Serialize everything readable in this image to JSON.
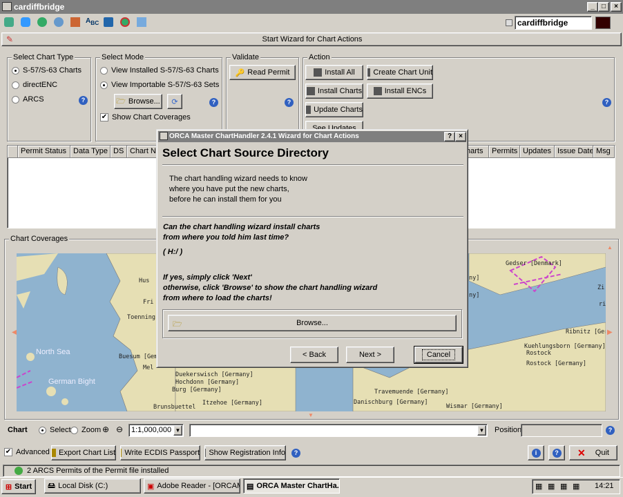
{
  "window": {
    "title": "cardiffbridge"
  },
  "toolbar": {
    "identity": "cardiffbridge",
    "wizard_label": "Start Wizard for Chart Actions"
  },
  "chart_type": {
    "label": "Select Chart Type",
    "options": [
      "S-57/S-63 Charts",
      "directENC",
      "ARCS"
    ],
    "selected": 0
  },
  "mode": {
    "label": "Select Mode",
    "options": [
      "View Installed S-57/S-63 Charts",
      "View Importable S-57/S-63 Sets"
    ],
    "selected": 1,
    "browse": "Browse...",
    "show_coverages": "Show Chart Coverages"
  },
  "validate": {
    "label": "Validate",
    "read_permit": "Read Permit"
  },
  "action": {
    "label": "Action",
    "install_all": "Install All",
    "create_chart_unit": "Create Chart Unit",
    "install_charts": "Install Charts",
    "install_encs": "Install ENCs",
    "update_charts": "Update Charts",
    "see_updates": "See Updates"
  },
  "table": {
    "columns_left": [
      "Permit Status",
      "Data Type",
      "DS",
      "Chart No"
    ],
    "columns_right": [
      "harts",
      "Permits",
      "Updates",
      "Issue Date",
      "Msg"
    ]
  },
  "coverages": {
    "label": "Chart Coverages",
    "sea_labels": [
      "North Sea",
      "German Bight"
    ],
    "places": [
      "Hus",
      "Fri",
      "Toenning",
      "Buesum [Gem",
      "Mel",
      "Duekerswisch [Germany]",
      "Hochdonn [Germany]",
      "Burg [Germany]",
      "Brunsbuettel",
      "Itzehoe [Germany]",
      "Gedser [Denmark]",
      "ny]",
      "ny]",
      "Zi",
      "ri",
      "Ribnitz [Germany]",
      "Kuehlungsborn [Germany]",
      "Rostock",
      "Rostock [Germany]",
      "Travemuende [Germany]",
      "Danischburg [Germany]",
      "Wismar [Germany]"
    ]
  },
  "chartbar": {
    "label": "Chart",
    "select": "Select",
    "zoom": "Zoom",
    "scale": "1:1,000,000",
    "position_label": "Position:"
  },
  "bottom": {
    "advanced": "Advanced",
    "export": "Export Chart List",
    "write_ecdis": "Write ECDIS Passport",
    "show_reg": "Show Registration Info",
    "quit": "Quit"
  },
  "status": {
    "message": "2 ARCS Permits of the Permit file installed"
  },
  "taskbar": {
    "start": "Start",
    "items": [
      "Local Disk (C:)",
      "Adobe Reader - [ORCAM...",
      "ORCA Master ChartHa..."
    ],
    "clock": "14:21"
  },
  "dialog": {
    "title": "ORCA Master ChartHandler 2.4.1 Wizard for Chart Actions",
    "heading": "Select Chart Source Directory",
    "intro": [
      "The chart handling wizard needs to know",
      "where you have put the new charts,",
      "before he can install them for you"
    ],
    "question": [
      "Can the chart handling wizard install charts",
      "from where you told him last time?"
    ],
    "path": "( H:/ )",
    "hint": [
      "If yes, simply click 'Next'",
      "otherwise, click 'Browse' to show the chart handling wizard",
      "from where to load the charts!"
    ],
    "browse": "Browse...",
    "back": "< Back",
    "next": "Next >",
    "cancel": "Cancel"
  }
}
